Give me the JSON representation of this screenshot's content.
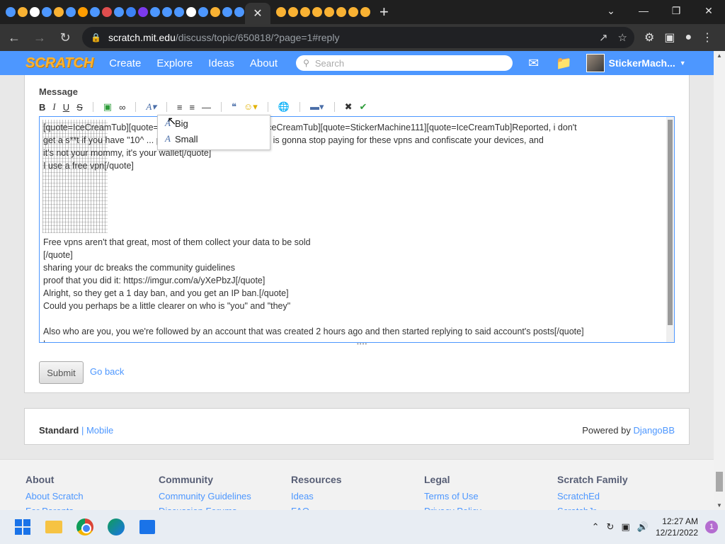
{
  "browser": {
    "tab_favicon_colors": [
      "#4d97ff",
      "#f9b233",
      "#ffffff",
      "#4d97ff",
      "#f9b233",
      "#4d97ff",
      "#ff9d00",
      "#4d97ff",
      "#e04e4e",
      "#4d97ff",
      "#3b82f6",
      "#7c3aed",
      "#4d97ff",
      "#4d97ff",
      "#4d97ff",
      "#ffffff",
      "#4d97ff",
      "#f9b233",
      "#4d97ff",
      "#4d97ff",
      "#f9b233",
      "#f9b233",
      "#f9b233",
      "#f9b233",
      "#f9b233",
      "#f9b233",
      "#f9b233",
      "#f9b233"
    ],
    "active_tab_close": "✕",
    "url_host": "scratch.mit.edu",
    "url_path": "/discuss/topic/650818/?page=1#reply",
    "window_controls": [
      "⌄",
      "—",
      "❐",
      "✕"
    ]
  },
  "scratch_nav": {
    "logo": "SCRATCH",
    "links": [
      "Create",
      "Explore",
      "Ideas",
      "About"
    ],
    "search_placeholder": "Search",
    "username": "StickerMach..."
  },
  "form": {
    "message_label": "Message",
    "toolbar": {
      "bold": "B",
      "italic": "I",
      "underline": "U",
      "strike": "S"
    },
    "editor_lines": [
      "[quote=IceCreamTub][quote=StickerMachine111][quote=IceCreamTub][quote=StickerMachine111][quote=IceCreamTub]Reported, i don't",
      "get a s**t if you have \"10^ ... points\" one day your mommy is gonna stop paying for these vpns and confiscate your devices, and",
      "it's not your mommy, it's your wallet[/quote]",
      "I use a free vpn[/quote]",
      "",
      "",
      "",
      "",
      "",
      "Free vpns aren't that great, most of them collect your data to be sold",
      "[/quote]",
      "sharing your dc breaks the community guidelines",
      "proof that you did it: https://imgur.com/a/yXePbzJ[/quote]",
      "Alright, so they get a 1 day ban, and you get an IP ban.[/quote]",
      "Could you perhaps be a little clearer on who is \"you\" and \"they\"",
      "",
      "Also who are you, you we're followed by an account that was created 2 hours ago and then started replying to said account's posts[/quote]",
      "|"
    ],
    "size_dropdown": {
      "options": [
        "Big",
        "Small"
      ]
    },
    "submit_label": "Submit",
    "go_back_label": "Go back"
  },
  "forum_footer": {
    "standard": "Standard",
    "separator": " | ",
    "mobile": "Mobile",
    "powered_by": "Powered by ",
    "djangobb": "DjangoBB"
  },
  "site_footer": {
    "columns": [
      {
        "title": "About",
        "links": [
          "About Scratch",
          "For Parents"
        ]
      },
      {
        "title": "Community",
        "links": [
          "Community Guidelines",
          "Discussion Forums"
        ]
      },
      {
        "title": "Resources",
        "links": [
          "Ideas",
          "FAQ"
        ]
      },
      {
        "title": "Legal",
        "links": [
          "Terms of Use",
          "Privacy Policy"
        ]
      },
      {
        "title": "Scratch Family",
        "links": [
          "ScratchEd",
          "ScratchJr"
        ]
      }
    ]
  },
  "taskbar": {
    "time": "12:27 AM",
    "date": "12/21/2022",
    "notification_count": "1"
  }
}
